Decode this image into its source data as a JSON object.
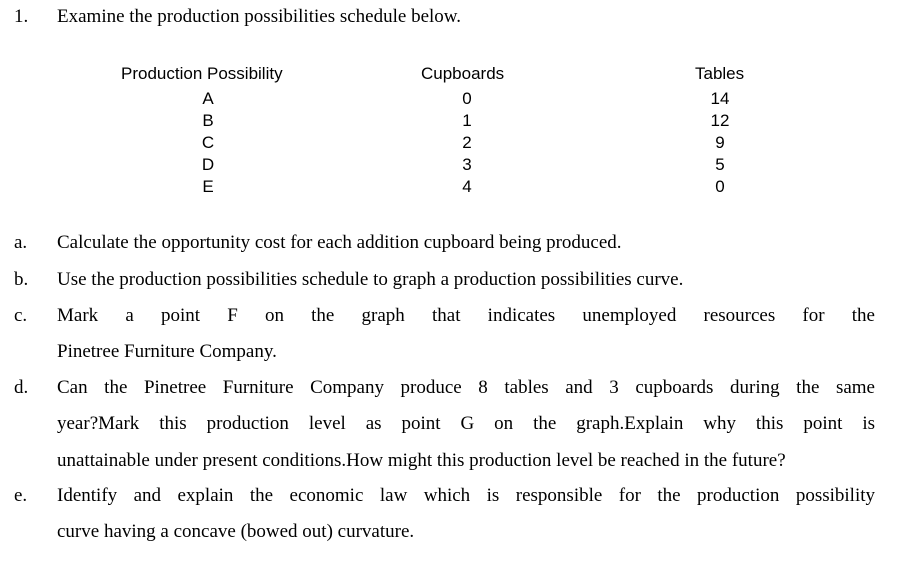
{
  "question": {
    "number": "1.",
    "intro": "Examine the production possibilities schedule below."
  },
  "schedule": {
    "headers": {
      "possibility": "Production Possibility",
      "cupboards": "Cupboards",
      "tables": "Tables"
    },
    "rows": [
      {
        "possibility": "A",
        "cupboards": "0",
        "tables": "14"
      },
      {
        "possibility": "B",
        "cupboards": "1",
        "tables": "12"
      },
      {
        "possibility": "C",
        "cupboards": "2",
        "tables": "9"
      },
      {
        "possibility": "D",
        "cupboards": "3",
        "tables": "5"
      },
      {
        "possibility": "E",
        "cupboards": "4",
        "tables": "0"
      }
    ]
  },
  "parts": {
    "a": {
      "letter": "a.",
      "lines": [
        "Calculate the opportunity cost for each addition cupboard being produced."
      ]
    },
    "b": {
      "letter": "b.",
      "lines": [
        "Use the production possibilities schedule to graph a production possibilities curve."
      ]
    },
    "c": {
      "letter": "c.",
      "lines": [
        "Mark a point F on the graph that indicates unemployed resources for the",
        "Pinetree Furniture Company."
      ]
    },
    "d": {
      "letter": "d.",
      "lines": [
        "Can the Pinetree Furniture Company produce 8 tables and 3 cupboards during the same",
        "year?Mark this production level as point G on the graph.Explain why this point is",
        "unattainable under present conditions.How might this production level be reached in the future?"
      ]
    },
    "e": {
      "letter": "e.",
      "lines": [
        "Identify and explain the economic law which is responsible for the production possibility",
        "curve having a concave (bowed out) curvature."
      ]
    }
  }
}
